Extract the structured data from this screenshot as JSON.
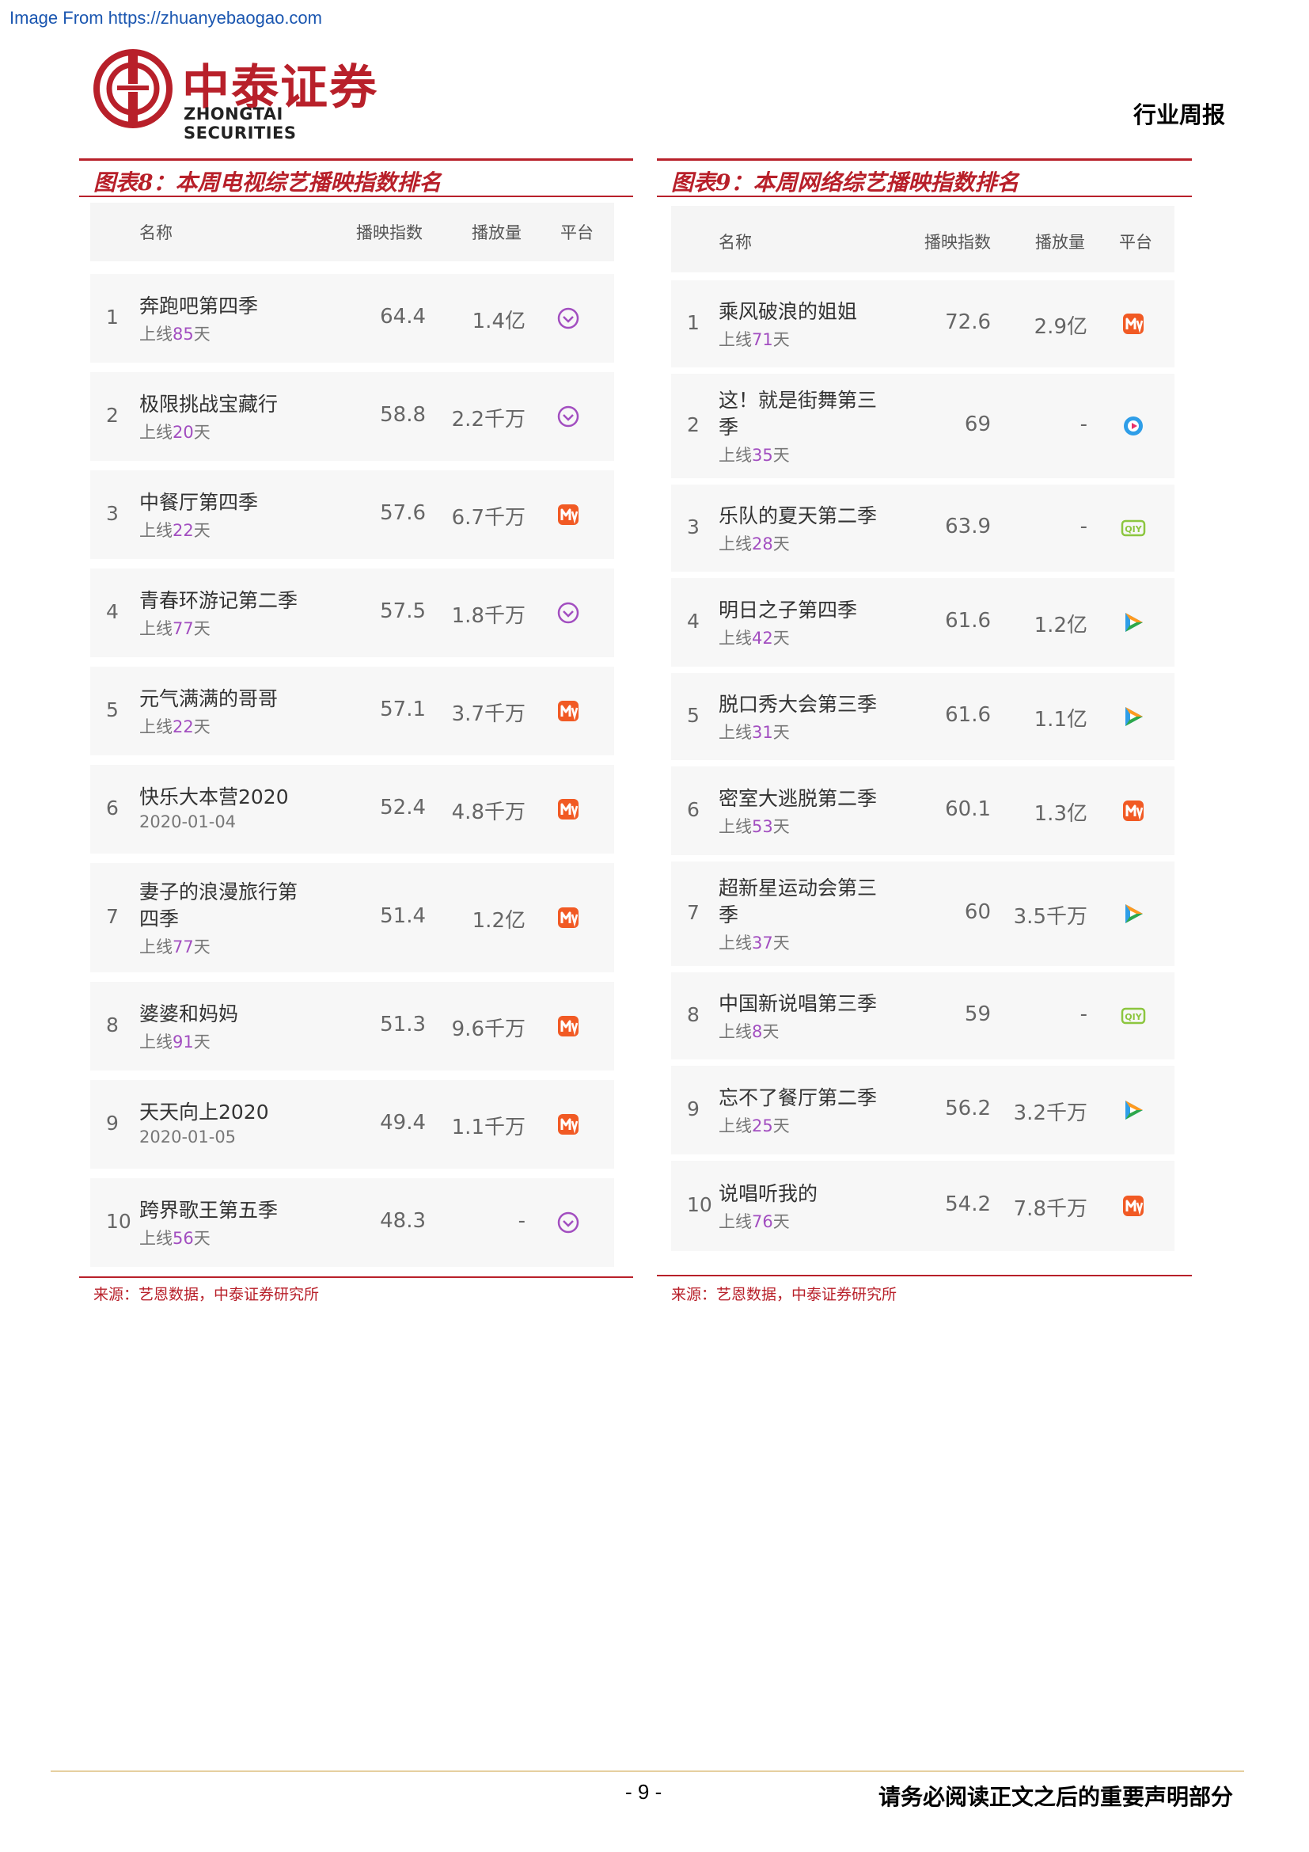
{
  "watermark": "Image From https://zhuanyebaogao.com",
  "logo": {
    "cn": "中泰证券",
    "en": "ZHONGTAI SECURITIES"
  },
  "doc_type": "行业周报",
  "colors": {
    "brand_red": "#b8202a",
    "mango": "#f15a24",
    "youku": "#a24ec0",
    "tencent": "#2f9ee8",
    "iqiyi": "#8cc63f"
  },
  "left": {
    "title": "图表8：本周电视综艺播映指数排名",
    "headers": {
      "name": "名称",
      "index": "播映指数",
      "views": "播放量",
      "platform": "平台"
    },
    "rows": [
      {
        "rank": "1",
        "name": [
          "奔跑吧第四季"
        ],
        "sub_prefix": "上线",
        "sub_num": "85",
        "sub_suffix": "天",
        "index": "64.4",
        "views": "1.4亿",
        "platform": "youku-icon"
      },
      {
        "rank": "2",
        "name": [
          "极限挑战宝藏行"
        ],
        "sub_prefix": "上线",
        "sub_num": "20",
        "sub_suffix": "天",
        "index": "58.8",
        "views": "2.2千万",
        "platform": "youku-icon"
      },
      {
        "rank": "3",
        "name": [
          "中餐厅第四季"
        ],
        "sub_prefix": "上线",
        "sub_num": "22",
        "sub_suffix": "天",
        "index": "57.6",
        "views": "6.7千万",
        "platform": "mango-icon"
      },
      {
        "rank": "4",
        "name": [
          "青春环游记第二季"
        ],
        "sub_prefix": "上线",
        "sub_num": "77",
        "sub_suffix": "天",
        "index": "57.5",
        "views": "1.8千万",
        "platform": "youku-icon"
      },
      {
        "rank": "5",
        "name": [
          "元气满满的哥哥"
        ],
        "sub_prefix": "上线",
        "sub_num": "22",
        "sub_suffix": "天",
        "index": "57.1",
        "views": "3.7千万",
        "platform": "mango-icon"
      },
      {
        "rank": "6",
        "name": [
          "快乐大本营2020"
        ],
        "sub_prefix": "2020-01-04",
        "sub_num": "",
        "sub_suffix": "",
        "index": "52.4",
        "views": "4.8千万",
        "platform": "mango-icon"
      },
      {
        "rank": "7",
        "name": [
          "妻子的浪漫旅行第",
          "四季"
        ],
        "sub_prefix": "上线",
        "sub_num": "77",
        "sub_suffix": "天",
        "index": "51.4",
        "views": "1.2亿",
        "platform": "mango-icon"
      },
      {
        "rank": "8",
        "name": [
          "婆婆和妈妈"
        ],
        "sub_prefix": "上线",
        "sub_num": "91",
        "sub_suffix": "天",
        "index": "51.3",
        "views": "9.6千万",
        "platform": "mango-icon"
      },
      {
        "rank": "9",
        "name": [
          "天天向上2020"
        ],
        "sub_prefix": "2020-01-05",
        "sub_num": "",
        "sub_suffix": "",
        "index": "49.4",
        "views": "1.1千万",
        "platform": "mango-icon"
      },
      {
        "rank": "10",
        "name": [
          "跨界歌王第五季"
        ],
        "sub_prefix": "上线",
        "sub_num": "56",
        "sub_suffix": "天",
        "index": "48.3",
        "views": "-",
        "platform": "youku-icon"
      }
    ],
    "source": "来源：艺恩数据，中泰证券研究所"
  },
  "right": {
    "title": "图表9：本周网络综艺播映指数排名",
    "headers": {
      "name": "名称",
      "index": "播映指数",
      "views": "播放量",
      "platform": "平台"
    },
    "rows": [
      {
        "rank": "1",
        "name": [
          "乘风破浪的姐姐"
        ],
        "sub_prefix": "上线",
        "sub_num": "71",
        "sub_suffix": "天",
        "index": "72.6",
        "views": "2.9亿",
        "platform": "mango-icon"
      },
      {
        "rank": "2",
        "name": [
          "这！就是街舞第三",
          "季"
        ],
        "sub_prefix": "上线",
        "sub_num": "35",
        "sub_suffix": "天",
        "index": "69",
        "views": "-",
        "platform": "youku-play-icon"
      },
      {
        "rank": "3",
        "name": [
          "乐队的夏天第二季"
        ],
        "sub_prefix": "上线",
        "sub_num": "28",
        "sub_suffix": "天",
        "index": "63.9",
        "views": "-",
        "platform": "iqiyi-icon"
      },
      {
        "rank": "4",
        "name": [
          "明日之子第四季"
        ],
        "sub_prefix": "上线",
        "sub_num": "42",
        "sub_suffix": "天",
        "index": "61.6",
        "views": "1.2亿",
        "platform": "tencent-icon"
      },
      {
        "rank": "5",
        "name": [
          "脱口秀大会第三季"
        ],
        "sub_prefix": "上线",
        "sub_num": "31",
        "sub_suffix": "天",
        "index": "61.6",
        "views": "1.1亿",
        "platform": "tencent-icon"
      },
      {
        "rank": "6",
        "name": [
          "密室大逃脱第二季"
        ],
        "sub_prefix": "上线",
        "sub_num": "53",
        "sub_suffix": "天",
        "index": "60.1",
        "views": "1.3亿",
        "platform": "mango-icon"
      },
      {
        "rank": "7",
        "name": [
          "超新星运动会第三",
          "季"
        ],
        "sub_prefix": "上线",
        "sub_num": "37",
        "sub_suffix": "天",
        "index": "60",
        "views": "3.5千万",
        "platform": "tencent-icon"
      },
      {
        "rank": "8",
        "name": [
          "中国新说唱第三季"
        ],
        "sub_prefix": "上线",
        "sub_num": "8",
        "sub_suffix": "天",
        "index": "59",
        "views": "-",
        "platform": "iqiyi-icon"
      },
      {
        "rank": "9",
        "name": [
          "忘不了餐厅第二季"
        ],
        "sub_prefix": "上线",
        "sub_num": "25",
        "sub_suffix": "天",
        "index": "56.2",
        "views": "3.2千万",
        "platform": "tencent-icon"
      },
      {
        "rank": "10",
        "name": [
          "说唱听我的"
        ],
        "sub_prefix": "上线",
        "sub_num": "76",
        "sub_suffix": "天",
        "index": "54.2",
        "views": "7.8千万",
        "platform": "mango-icon"
      }
    ],
    "source": "来源：艺恩数据，中泰证券研究所"
  },
  "footer": {
    "page": "- 9 -",
    "notice": "请务必阅读正文之后的重要声明部分"
  }
}
